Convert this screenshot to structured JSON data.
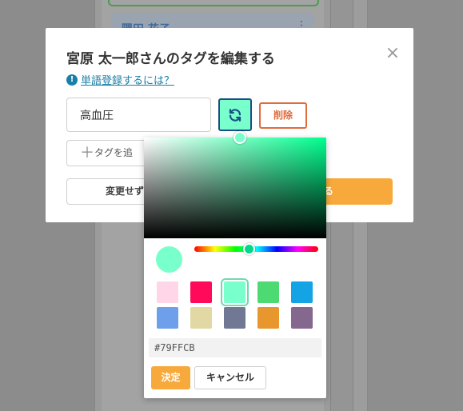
{
  "background": {
    "card_name": "隅田 花子",
    "card_menu_icon": "more-vertical-icon"
  },
  "dialog": {
    "title": "宮原 太一郎さんのタグを編集する",
    "close_icon": "close-icon",
    "help_icon": "exclamation-circle-icon",
    "help_link": "単語登録するには？",
    "tag_value": "高血圧",
    "refresh_icon": "refresh-icon",
    "delete_label": "削除",
    "add_tag_label": "タグを追",
    "cancel_changes_label": "変更せず",
    "save_label": "する"
  },
  "picker": {
    "current_color": "#79FFCB",
    "swatches": [
      "#FFD6E8",
      "#FF0A5B",
      "#79FFCB",
      "#4DDA72",
      "#14A3E5",
      "#6E9FEA",
      "#E1D8A3",
      "#717894",
      "#E8962E",
      "#85688E"
    ],
    "hex_value": "#79FFCB",
    "confirm_label": "決定",
    "cancel_label": "キャンセル"
  }
}
